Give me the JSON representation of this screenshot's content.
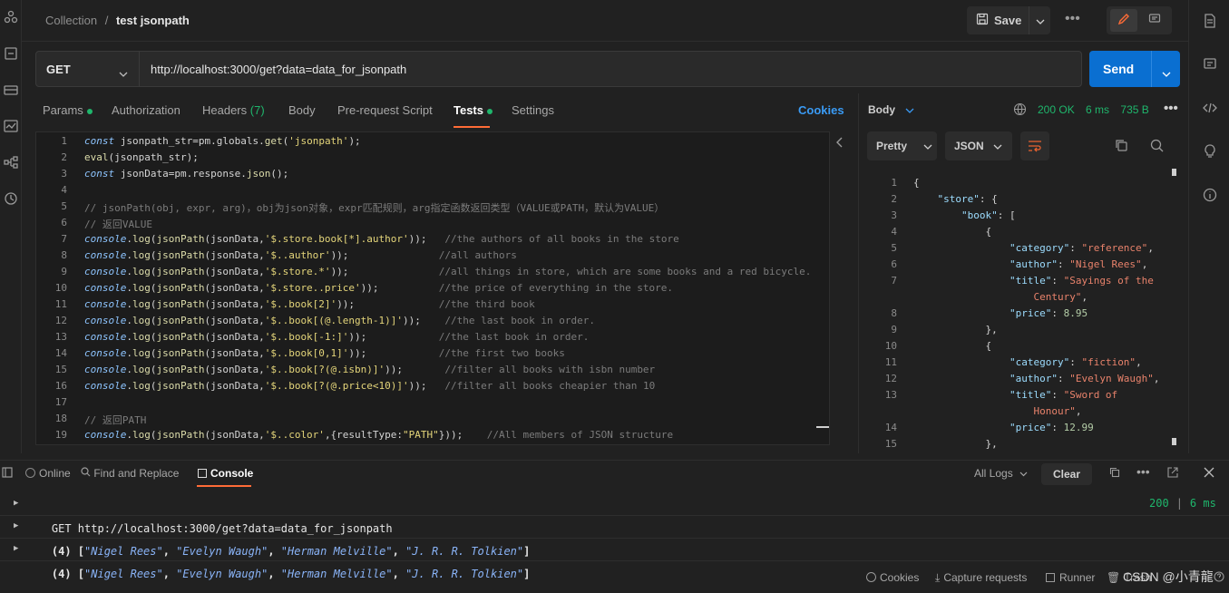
{
  "breadcrumb": {
    "collection": "Collection",
    "separator": "/",
    "request": "test jsonpath"
  },
  "toolbar": {
    "save": "Save",
    "more": "•••"
  },
  "request": {
    "method": "GET",
    "url": "http://localhost:3000/get?data=data_for_jsonpath",
    "send": "Send"
  },
  "tabs": [
    {
      "label": "Params",
      "dot": true
    },
    {
      "label": "Authorization"
    },
    {
      "label": "Headers",
      "count": "(7)"
    },
    {
      "label": "Body"
    },
    {
      "label": "Pre-request Script"
    },
    {
      "label": "Tests",
      "dot": true,
      "active": true
    },
    {
      "label": "Settings"
    }
  ],
  "cookies_link": "Cookies",
  "code_lines": [
    {
      "n": "1",
      "html": "<span class=\"kw\">const</span> jsonpath_str<span class=\"pn\">=</span>pm.globals.<span class=\"fn\">get</span>(<span class=\"st\">'jsonpath'</span>);"
    },
    {
      "n": "2",
      "html": "<span class=\"fn\">eval</span>(jsonpath_str);"
    },
    {
      "n": "3",
      "html": "<span class=\"kw\">const</span> jsonData<span class=\"pn\">=</span>pm.response.<span class=\"fn\">json</span>();"
    },
    {
      "n": "4",
      "html": ""
    },
    {
      "n": "5",
      "html": "<span class=\"cm\">// jsonPath(obj, expr, arg)，obj为json对象，expr匹配规则，arg指定函数返回类型（VALUE或PATH，默认为VALUE）</span>"
    },
    {
      "n": "6",
      "html": "<span class=\"cm\">// 返回VALUE</span>"
    },
    {
      "n": "7",
      "html": "<span class=\"kw\">console</span>.<span class=\"fn\">log</span>(<span class=\"fn\">jsonPath</span>(jsonData,<span class=\"st\">'$.store.book[*].author'</span>));   <span class=\"cm\">//the authors of all books in the store</span>"
    },
    {
      "n": "8",
      "html": "<span class=\"kw\">console</span>.<span class=\"fn\">log</span>(<span class=\"fn\">jsonPath</span>(jsonData,<span class=\"st\">'$..author'</span>));               <span class=\"cm\">//all authors</span>"
    },
    {
      "n": "9",
      "html": "<span class=\"kw\">console</span>.<span class=\"fn\">log</span>(<span class=\"fn\">jsonPath</span>(jsonData,<span class=\"st\">'$.store.*'</span>));               <span class=\"cm\">//all things in store, which are some books and a red bicycle.</span>"
    },
    {
      "n": "10",
      "html": "<span class=\"kw\">console</span>.<span class=\"fn\">log</span>(<span class=\"fn\">jsonPath</span>(jsonData,<span class=\"st\">'$.store..price'</span>));          <span class=\"cm\">//the price of everything in the store.</span>"
    },
    {
      "n": "11",
      "html": "<span class=\"kw\">console</span>.<span class=\"fn\">log</span>(<span class=\"fn\">jsonPath</span>(jsonData,<span class=\"st\">'$..book[2]'</span>));              <span class=\"cm\">//the third book</span>"
    },
    {
      "n": "12",
      "html": "<span class=\"kw\">console</span>.<span class=\"fn\">log</span>(<span class=\"fn\">jsonPath</span>(jsonData,<span class=\"st\">'$..book[(@.length-1)]'</span>));    <span class=\"cm\">//the last book in order.</span>"
    },
    {
      "n": "13",
      "html": "<span class=\"kw\">console</span>.<span class=\"fn\">log</span>(<span class=\"fn\">jsonPath</span>(jsonData,<span class=\"st\">'$..book[-1:]'</span>));            <span class=\"cm\">//the last book in order.</span>"
    },
    {
      "n": "14",
      "html": "<span class=\"kw\">console</span>.<span class=\"fn\">log</span>(<span class=\"fn\">jsonPath</span>(jsonData,<span class=\"st\">'$..book[0,1]'</span>));            <span class=\"cm\">//the first two books</span>"
    },
    {
      "n": "15",
      "html": "<span class=\"kw\">console</span>.<span class=\"fn\">log</span>(<span class=\"fn\">jsonPath</span>(jsonData,<span class=\"st\">'$..book[?(@.isbn)]'</span>));       <span class=\"cm\">//filter all books with isbn number</span>"
    },
    {
      "n": "16",
      "html": "<span class=\"kw\">console</span>.<span class=\"fn\">log</span>(<span class=\"fn\">jsonPath</span>(jsonData,<span class=\"st\">'$..book[?(@.price&lt;10)]'</span>));   <span class=\"cm\">//filter all books cheapier than 10</span>"
    },
    {
      "n": "17",
      "html": ""
    },
    {
      "n": "18",
      "html": "<span class=\"cm\">// 返回PATH</span>"
    },
    {
      "n": "19",
      "html": "<span class=\"kw\">console</span>.<span class=\"fn\">log</span>(<span class=\"fn\">jsonPath</span>(jsonData,<span class=\"st\">'$..color'</span>,{resultType:<span class=\"st\">\"PATH\"</span>}));    <span class=\"cm\">//All members of JSON structure</span>"
    }
  ],
  "response": {
    "label": "Body",
    "status": "200 OK",
    "time": "6 ms",
    "size": "735 B",
    "format": "Pretty",
    "type": "JSON",
    "lines": [
      {
        "n": "1",
        "html": "{"
      },
      {
        "n": "2",
        "html": "    <span class=\"jk\">\"store\"</span>: {"
      },
      {
        "n": "3",
        "html": "        <span class=\"jk\">\"book\"</span>: ["
      },
      {
        "n": "4",
        "html": "            {"
      },
      {
        "n": "5",
        "html": "                <span class=\"jk\">\"category\"</span>: <span class=\"js\">\"reference\"</span>,"
      },
      {
        "n": "6",
        "html": "                <span class=\"jk\">\"author\"</span>: <span class=\"js\">\"Nigel Rees\"</span>,"
      },
      {
        "n": "7",
        "html": "                <span class=\"jk\">\"title\"</span>: <span class=\"js\">\"Sayings of the</span>"
      },
      {
        "n": "",
        "html": "                    <span class=\"js\">Century\"</span>,"
      },
      {
        "n": "8",
        "html": "                <span class=\"jk\">\"price\"</span>: <span class=\"jn\">8.95</span>"
      },
      {
        "n": "9",
        "html": "            },"
      },
      {
        "n": "10",
        "html": "            {"
      },
      {
        "n": "11",
        "html": "                <span class=\"jk\">\"category\"</span>: <span class=\"js\">\"fiction\"</span>,"
      },
      {
        "n": "12",
        "html": "                <span class=\"jk\">\"author\"</span>: <span class=\"js\">\"Evelyn Waugh\"</span>,"
      },
      {
        "n": "13",
        "html": "                <span class=\"jk\">\"title\"</span>: <span class=\"js\">\"Sword of</span>"
      },
      {
        "n": "",
        "html": "                    <span class=\"js\">Honour\"</span>,"
      },
      {
        "n": "14",
        "html": "                <span class=\"jk\">\"price\"</span>: <span class=\"jn\">12.99</span>"
      },
      {
        "n": "15",
        "html": "            },"
      }
    ]
  },
  "bottom_tabs": {
    "online": "Online",
    "find": "Find and Replace",
    "console": "Console",
    "all_logs": "All Logs",
    "clear": "Clear"
  },
  "console_lines": {
    "get_line": "GET http://localhost:3000/get?data=data_for_jsonpath",
    "get_status": "200",
    "get_time": "6 ms",
    "log1_prefix": "(4) [",
    "log2_prefix": "(4) [",
    "items": [
      "\"Nigel Rees\"",
      "\"Evelyn Waugh\"",
      "\"Herman Melville\"",
      "\"J. R. R. Tolkien\""
    ],
    "suffix": "]"
  },
  "footer": {
    "cookies": "Cookies",
    "capture": "Capture requests",
    "runner": "Runner",
    "trash": "Trash",
    "watermark": "CSDN @小青龍"
  }
}
